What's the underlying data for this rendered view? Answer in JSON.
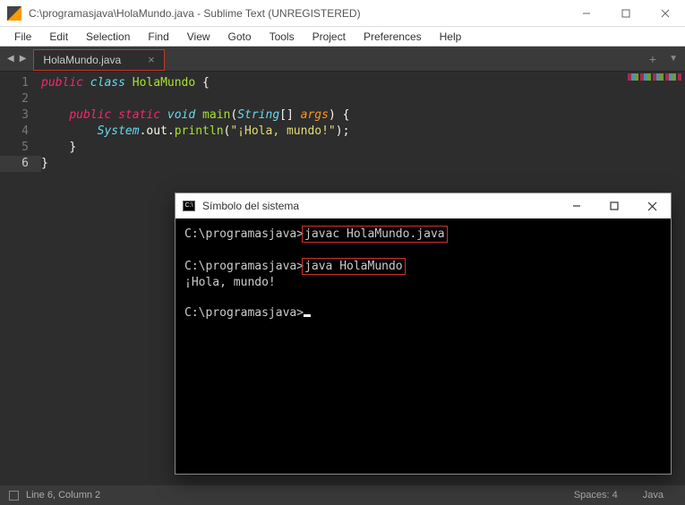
{
  "window": {
    "title": "C:\\programasjava\\HolaMundo.java - Sublime Text (UNREGISTERED)"
  },
  "menu": {
    "items": [
      "File",
      "Edit",
      "Selection",
      "Find",
      "View",
      "Goto",
      "Tools",
      "Project",
      "Preferences",
      "Help"
    ]
  },
  "tabs": {
    "active": "HolaMundo.java",
    "close_glyph": "×",
    "add_glyph": "+",
    "drop_glyph": "▼"
  },
  "gutter": {
    "lines": [
      "1",
      "2",
      "3",
      "4",
      "5",
      "6"
    ],
    "current": 6
  },
  "code": {
    "l1": {
      "public": "public",
      "class": "class",
      "name": "HolaMundo",
      "brace": " {"
    },
    "l3": {
      "public": "public",
      "static": "static",
      "void": "void",
      "main": "main",
      "lp": "(",
      "type": "String",
      "br": "[] ",
      "arg": "args",
      "rp": ") {"
    },
    "l4": {
      "system": "System",
      "dot1": ".",
      "out": "out",
      "dot2": ".",
      "println": "println",
      "lp": "(",
      "str": "\"¡Hola, mundo!\"",
      "rp": ");"
    },
    "l5": {
      "brace": "}"
    },
    "l6": {
      "brace": "}"
    }
  },
  "statusbar": {
    "pos": "Line 6, Column 2",
    "spaces": "Spaces: 4",
    "lang": "Java"
  },
  "cmd": {
    "title": "Símbolo del sistema",
    "icon_text": "C:\\",
    "line1_prompt": "C:\\programasjava>",
    "line1_cmd": "javac HolaMundo.java",
    "line2_prompt": "C:\\programasjava>",
    "line2_cmd": "java HolaMundo",
    "line3_out": "¡Hola, mundo!",
    "line4_prompt": "C:\\programasjava>"
  }
}
